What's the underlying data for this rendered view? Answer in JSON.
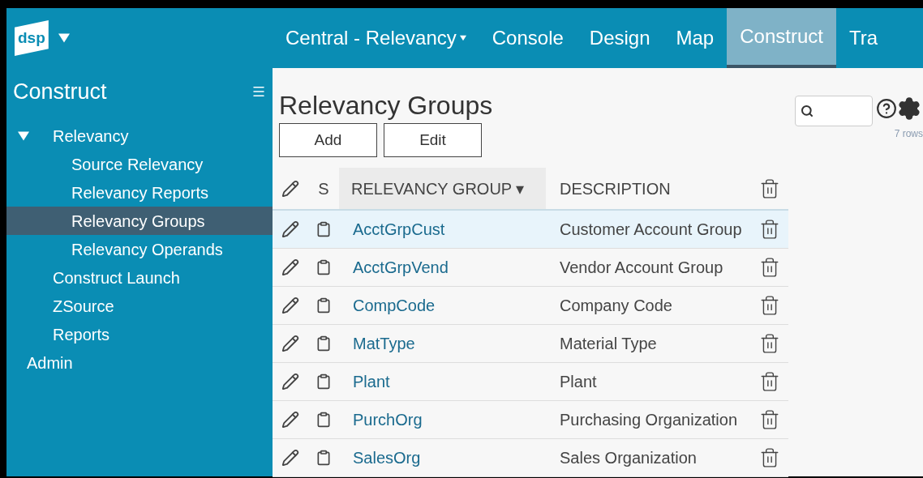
{
  "header": {
    "logo": "dsp",
    "nav": [
      {
        "label": "Central - Relevancy",
        "dropdown": true,
        "selected": false
      },
      {
        "label": "Console",
        "dropdown": false,
        "selected": false
      },
      {
        "label": "Design",
        "dropdown": false,
        "selected": false
      },
      {
        "label": "Map",
        "dropdown": false,
        "selected": false
      },
      {
        "label": "Construct",
        "dropdown": false,
        "selected": true
      },
      {
        "label": "Tra",
        "dropdown": false,
        "selected": false
      }
    ]
  },
  "sidebar": {
    "title": "Construct",
    "items": [
      {
        "label": "Relevancy",
        "expanded": true,
        "selected": false,
        "children": [
          {
            "label": "Source Relevancy",
            "selected": false
          },
          {
            "label": "Relevancy Reports",
            "selected": false
          },
          {
            "label": "Relevancy Groups",
            "selected": true
          },
          {
            "label": "Relevancy Operands",
            "selected": false
          }
        ]
      },
      {
        "label": "Construct Launch",
        "selected": false
      },
      {
        "label": "ZSource",
        "selected": false
      },
      {
        "label": "Reports",
        "selected": false
      }
    ],
    "footer_item": {
      "label": "Admin",
      "selected": false
    }
  },
  "page": {
    "title": "Relevancy Groups",
    "buttons": [
      "Add",
      "Edit"
    ],
    "row_count": "7 rows"
  },
  "table": {
    "columns": [
      {
        "label": "S",
        "sorted": false
      },
      {
        "label": "RELEVANCY GROUP ▾",
        "sorted": true
      },
      {
        "label": "DESCRIPTION",
        "sorted": false
      }
    ],
    "rows": [
      {
        "group": "AcctGrpCust",
        "description": "Customer Account Group",
        "selected": true
      },
      {
        "group": "AcctGrpVend",
        "description": "Vendor Account Group",
        "selected": false
      },
      {
        "group": "CompCode",
        "description": "Company Code",
        "selected": false
      },
      {
        "group": "MatType",
        "description": "Material Type",
        "selected": false
      },
      {
        "group": "Plant",
        "description": "Plant",
        "selected": false
      },
      {
        "group": "PurchOrg",
        "description": "Purchasing Organization",
        "selected": false
      },
      {
        "group": "SalesOrg",
        "description": "Sales Organization",
        "selected": false
      }
    ]
  }
}
